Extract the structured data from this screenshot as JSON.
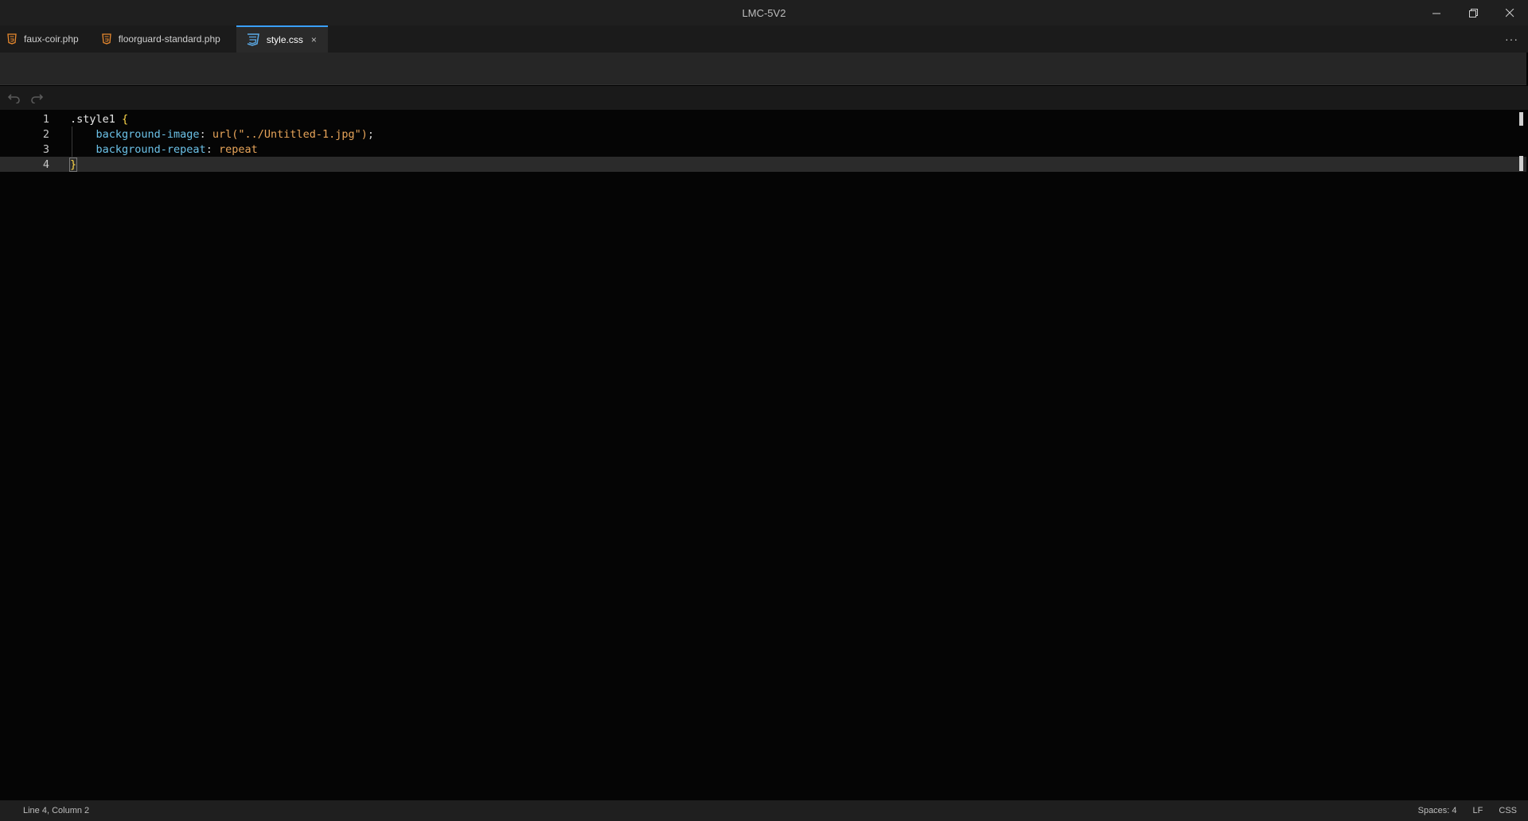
{
  "window": {
    "title": "LMC-5V2",
    "minimize_glyph": "—",
    "restore_glyph": "❐",
    "close_glyph": "✕"
  },
  "tabs": [
    {
      "label": "faux-coir.php",
      "icon": "html5-icon",
      "active": false
    },
    {
      "label": "floorguard-standard.php",
      "icon": "html5-icon",
      "active": false
    },
    {
      "label": "style.css",
      "icon": "css3-icon",
      "active": true,
      "close_glyph": "×"
    }
  ],
  "tab_overflow_glyph": "···",
  "editor": {
    "lines": [
      {
        "number": "1",
        "tokens": [
          {
            "t": ".style1 ",
            "c": "sel"
          },
          {
            "t": "{",
            "c": "punc"
          }
        ]
      },
      {
        "number": "2",
        "tokens": [
          {
            "t": "    ",
            "c": "punc"
          },
          {
            "t": "background-image",
            "c": "prop"
          },
          {
            "t": ": ",
            "c": "colon"
          },
          {
            "t": "url(\"../Untitled-1.jpg\")",
            "c": "val"
          },
          {
            "t": ";",
            "c": "punc"
          }
        ]
      },
      {
        "number": "3",
        "tokens": [
          {
            "t": "    ",
            "c": "punc"
          },
          {
            "t": "background-repeat",
            "c": "prop"
          },
          {
            "t": ": ",
            "c": "colon"
          },
          {
            "t": "repeat",
            "c": "val"
          }
        ]
      },
      {
        "number": "4",
        "tokens": [
          {
            "t": "}",
            "c": "brace"
          }
        ]
      }
    ],
    "current_line": 4
  },
  "status": {
    "cursor": "Line 4, Column 2",
    "indent": "Spaces: 4",
    "line_ending": "LF",
    "language": "CSS"
  },
  "colors": {
    "accent": "#3aa0ff",
    "html_icon": "#e8892e",
    "css_icon": "#5aa9e6"
  }
}
